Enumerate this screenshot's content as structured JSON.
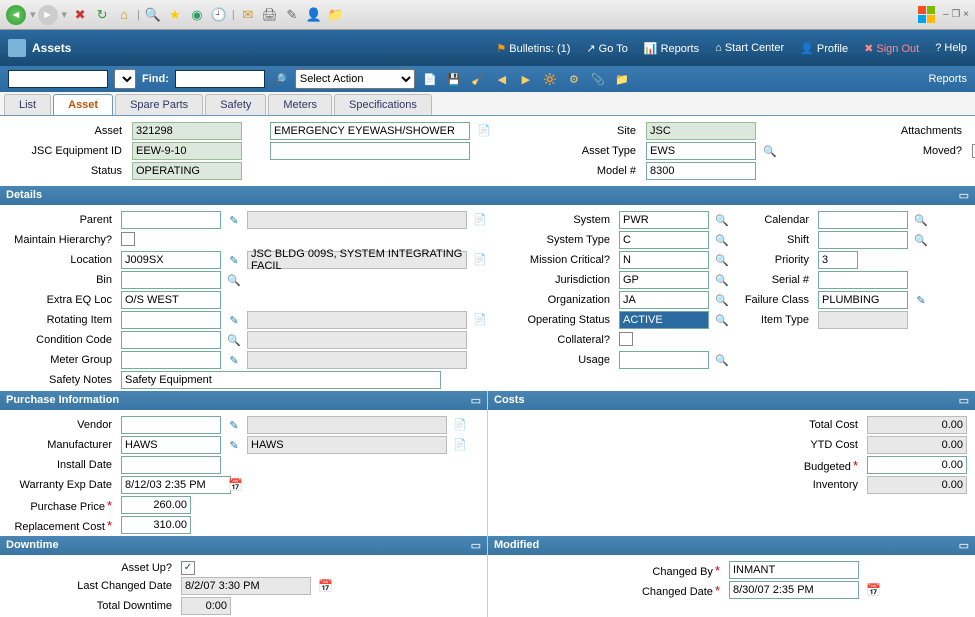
{
  "browser": {
    "icons": [
      "back",
      "dd",
      "fwd",
      "dd",
      "stop",
      "refresh",
      "home",
      "sep",
      "search",
      "fav",
      "media",
      "hist",
      "sep",
      "mail",
      "print",
      "edit",
      "msgr",
      "folder"
    ]
  },
  "window": {
    "ctrl": "–  ❐  ×"
  },
  "header": {
    "app": "Assets",
    "bulletins_label": "Bulletins:  (1)",
    "links": [
      "Go To",
      "Reports",
      "Start Center",
      "Profile",
      "Sign Out",
      "Help"
    ]
  },
  "toolbar": {
    "find_label": "Find:",
    "select_action": "Select Action",
    "reports_label": "Reports"
  },
  "tabs": [
    "List",
    "Asset",
    "Spare Parts",
    "Safety",
    "Meters",
    "Specifications"
  ],
  "active_tab": "Asset",
  "top": {
    "asset_lbl": "Asset",
    "asset": "321298",
    "asset_desc": "EMERGENCY EYEWASH/SHOWER",
    "site_lbl": "Site",
    "site": "JSC",
    "attach_lbl": "Attachments",
    "jsc_lbl": "JSC Equipment ID",
    "jsc": "EEW-9-10",
    "type_lbl": "Asset Type",
    "type": "EWS",
    "moved_lbl": "Moved?",
    "status_lbl": "Status",
    "status": "OPERATING",
    "model_lbl": "Model #",
    "model": "8300"
  },
  "sections": {
    "details": "Details",
    "purchase": "Purchase Information",
    "costs": "Costs",
    "downtime": "Downtime",
    "modified": "Modified"
  },
  "details": {
    "parent_lbl": "Parent",
    "parent": "",
    "system_lbl": "System",
    "system": "PWR",
    "calendar_lbl": "Calendar",
    "calendar": "",
    "maintain_lbl": "Maintain Hierarchy?",
    "systype_lbl": "System Type",
    "systype": "C",
    "shift_lbl": "Shift",
    "shift": "",
    "location_lbl": "Location",
    "location": "J009SX",
    "location_desc": "JSC BLDG 009S, SYSTEM INTEGRATING FACIL",
    "mission_lbl": "Mission Critical?",
    "mission": "N",
    "priority_lbl": "Priority",
    "priority": "3",
    "bin_lbl": "Bin",
    "bin": "",
    "jurisdiction_lbl": "Jurisdiction",
    "jurisdiction": "GP",
    "serial_lbl": "Serial #",
    "serial": "",
    "extra_lbl": "Extra EQ Loc",
    "extra": "O/S WEST",
    "org_lbl": "Organization",
    "org": "JA",
    "failure_lbl": "Failure Class",
    "failure": "PLUMBING",
    "rotating_lbl": "Rotating Item",
    "rotating": "",
    "opstatus_lbl": "Operating Status",
    "opstatus": "ACTIVE",
    "itemtype_lbl": "Item Type",
    "itemtype": "",
    "cond_lbl": "Condition Code",
    "cond": "",
    "collateral_lbl": "Collateral?",
    "meter_lbl": "Meter Group",
    "meter": "",
    "usage_lbl": "Usage",
    "usage": "",
    "safety_lbl": "Safety Notes",
    "safety": "Safety Equipment"
  },
  "purchase": {
    "vendor_lbl": "Vendor",
    "vendor": "",
    "mfr_lbl": "Manufacturer",
    "mfr": "HAWS",
    "mfr_desc": "HAWS",
    "install_lbl": "Install Date",
    "install": "",
    "warranty_lbl": "Warranty Exp Date",
    "warranty": "8/12/03 2:35 PM",
    "price_lbl": "Purchase Price",
    "price": "260.00",
    "replace_lbl": "Replacement Cost",
    "replace": "310.00"
  },
  "costs": {
    "total_lbl": "Total Cost",
    "total": "0.00",
    "ytd_lbl": "YTD Cost",
    "ytd": "0.00",
    "budget_lbl": "Budgeted",
    "budget": "0.00",
    "inv_lbl": "Inventory",
    "inv": "0.00"
  },
  "downtime": {
    "up_lbl": "Asset Up?",
    "up": "✓",
    "changed_lbl": "Last Changed Date",
    "changed": "8/2/07 3:30 PM",
    "total_lbl": "Total Downtime",
    "total": "0:00"
  },
  "modified": {
    "by_lbl": "Changed By",
    "by": "INMANT",
    "date_lbl": "Changed Date",
    "date": "8/30/07 2:35 PM"
  }
}
